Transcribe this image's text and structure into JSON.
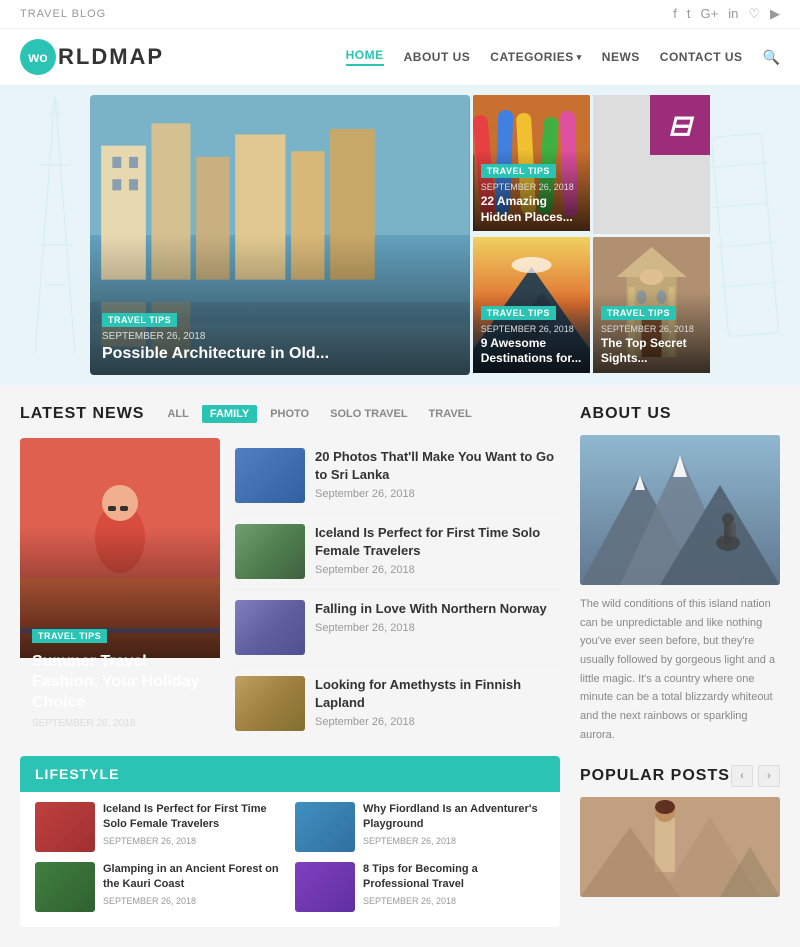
{
  "topbar": {
    "label": "TRAVEL BLOG",
    "icons": [
      "f",
      "t",
      "G+",
      "in",
      "♡",
      "▶"
    ]
  },
  "header": {
    "logo_wo": "wo",
    "logo_rest": "RLDMAP",
    "nav": [
      {
        "label": "HOME",
        "active": true
      },
      {
        "label": "ABOUT US",
        "active": false
      },
      {
        "label": "CATEGORIES",
        "active": false,
        "has_arrow": true
      },
      {
        "label": "NEWS",
        "active": false
      },
      {
        "label": "CONTACT US",
        "active": false
      }
    ]
  },
  "hero": {
    "main": {
      "tag": "TRAVEL TIPS",
      "date": "SEPTEMBER 26, 2018",
      "title": "Possible Architecture in Old..."
    },
    "items": [
      {
        "tag": "TRAVEL TIPS",
        "date": "SEPTEMBER 26, 2018",
        "title": "22 Amazing Hidden Places..."
      },
      {
        "tag": "TRAVEL TIPS",
        "date": "SEPTEMBER 26, 2018",
        "title": "9 Awesome Destinations for..."
      },
      {
        "tag": "TRAVEL TIPS",
        "date": "SEPTEMBER 26, 2018",
        "title": "The Top Secret Sights..."
      }
    ]
  },
  "latest_news": {
    "title": "LATEST NEWS",
    "filters": [
      "ALL",
      "FAMILY",
      "PHOTO",
      "SOLO TRAVEL",
      "TRAVEL"
    ],
    "active_filter": "FAMILY",
    "featured": {
      "tag": "TRAVEL TIPS",
      "title": "Summer Travel Fashion, Your Holiday Choice",
      "date": "SEPTEMBER 26, 2018"
    },
    "items": [
      {
        "title": "20 Photos That'll Make You Want to Go to Sri Lanka",
        "date": "September 26, 2018"
      },
      {
        "title": "Iceland Is Perfect for First Time Solo Female Travelers",
        "date": "September 26, 2018"
      },
      {
        "title": "Falling in Love With Northern Norway",
        "date": "September 26, 2018"
      },
      {
        "title": "Looking for Amethysts in Finnish Lapland",
        "date": "September 26, 2018"
      }
    ]
  },
  "lifestyle": {
    "title": "LIFESTYLE",
    "items": [
      {
        "title": "Iceland Is Perfect for First Time Solo Female Travelers",
        "date": "SEPTEMBER 26, 2018"
      },
      {
        "title": "Why Fiordland Is an Adventurer's Playground",
        "date": "SEPTEMBER 26, 2018"
      },
      {
        "title": "Glamping in an Ancient Forest on the Kauri Coast",
        "date": "SEPTEMBER 26, 2018"
      },
      {
        "title": "8 Tips for Becoming a Professional Travel",
        "date": "SEPTEMBER 26, 2018"
      }
    ]
  },
  "about": {
    "title": "ABOUT US",
    "text": "The wild conditions of this island nation can be unpredictable and like nothing you've ever seen before, but they're usually followed by gorgeous light and a little magic. It's a country where one minute can be a total blizzardy whiteout and the next rainbows or sparkling aurora."
  },
  "popular": {
    "title": "POPULAR POSTS",
    "nav_prev": "‹",
    "nav_next": "›"
  }
}
